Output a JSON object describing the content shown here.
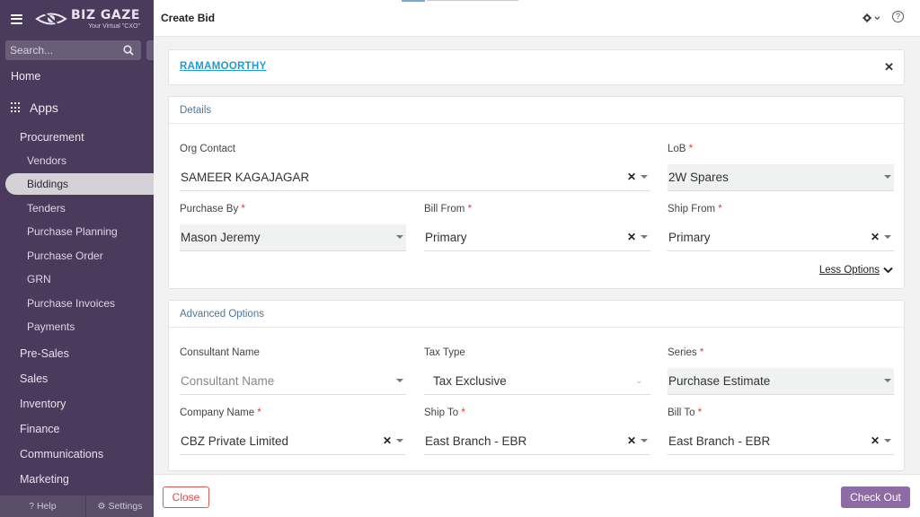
{
  "brand": {
    "title": "BIZ GAZE",
    "tagline": "Your Virtual \"CXO\""
  },
  "search": {
    "placeholder": "Search..."
  },
  "nav": {
    "home": "Home",
    "apps": "Apps",
    "procurement": "Procurement",
    "sub_items": [
      "Vendors",
      "Biddings",
      "Tenders",
      "Purchase Planning",
      "Purchase Order",
      "GRN",
      "Purchase Invoices",
      "Payments"
    ],
    "active": "Biddings",
    "sections": [
      "Pre-Sales",
      "Sales",
      "Inventory",
      "Finance",
      "Communications",
      "Marketing"
    ]
  },
  "sidebar_footer": {
    "help": "Help",
    "settings": "Settings"
  },
  "page": {
    "title": "Create Bid"
  },
  "contact": {
    "name": "RAMAMOORTHY"
  },
  "details": {
    "heading": "Details",
    "fields": [
      {
        "label": "Org Contact",
        "required": false,
        "value": "SAMEER KAGAJAGAR"
      },
      {
        "label": "LoB",
        "required": true,
        "value": "2W Spares"
      },
      {
        "label": "Purchase By",
        "required": true,
        "value": "Mason Jeremy"
      },
      {
        "label": "Bill From",
        "required": true,
        "value": "Primary"
      },
      {
        "label": "Ship From",
        "required": true,
        "value": "Primary"
      }
    ],
    "less_options": "Less Options"
  },
  "advanced": {
    "heading": "Advanced Options",
    "fields": [
      {
        "label": "Consultant Name",
        "required": false,
        "value": "",
        "placeholder": "Consultant Name"
      },
      {
        "label": "Tax Type",
        "required": false,
        "value": "Tax Exclusive"
      },
      {
        "label": "Series",
        "required": true,
        "value": "Purchase Estimate"
      },
      {
        "label": "Company Name",
        "required": true,
        "value": "CBZ Private Limited"
      },
      {
        "label": "Ship To",
        "required": true,
        "value": "East Branch - EBR"
      },
      {
        "label": "Bill To",
        "required": true,
        "value": "East Branch - EBR"
      }
    ]
  },
  "actions": {
    "close": "Close",
    "checkout": "Check Out"
  },
  "colors": {
    "sidebar": "#4a3b5c",
    "accent": "#8e6ba5",
    "link": "#1f9bd6",
    "required": "#e53935",
    "close": "#d84a4a"
  }
}
